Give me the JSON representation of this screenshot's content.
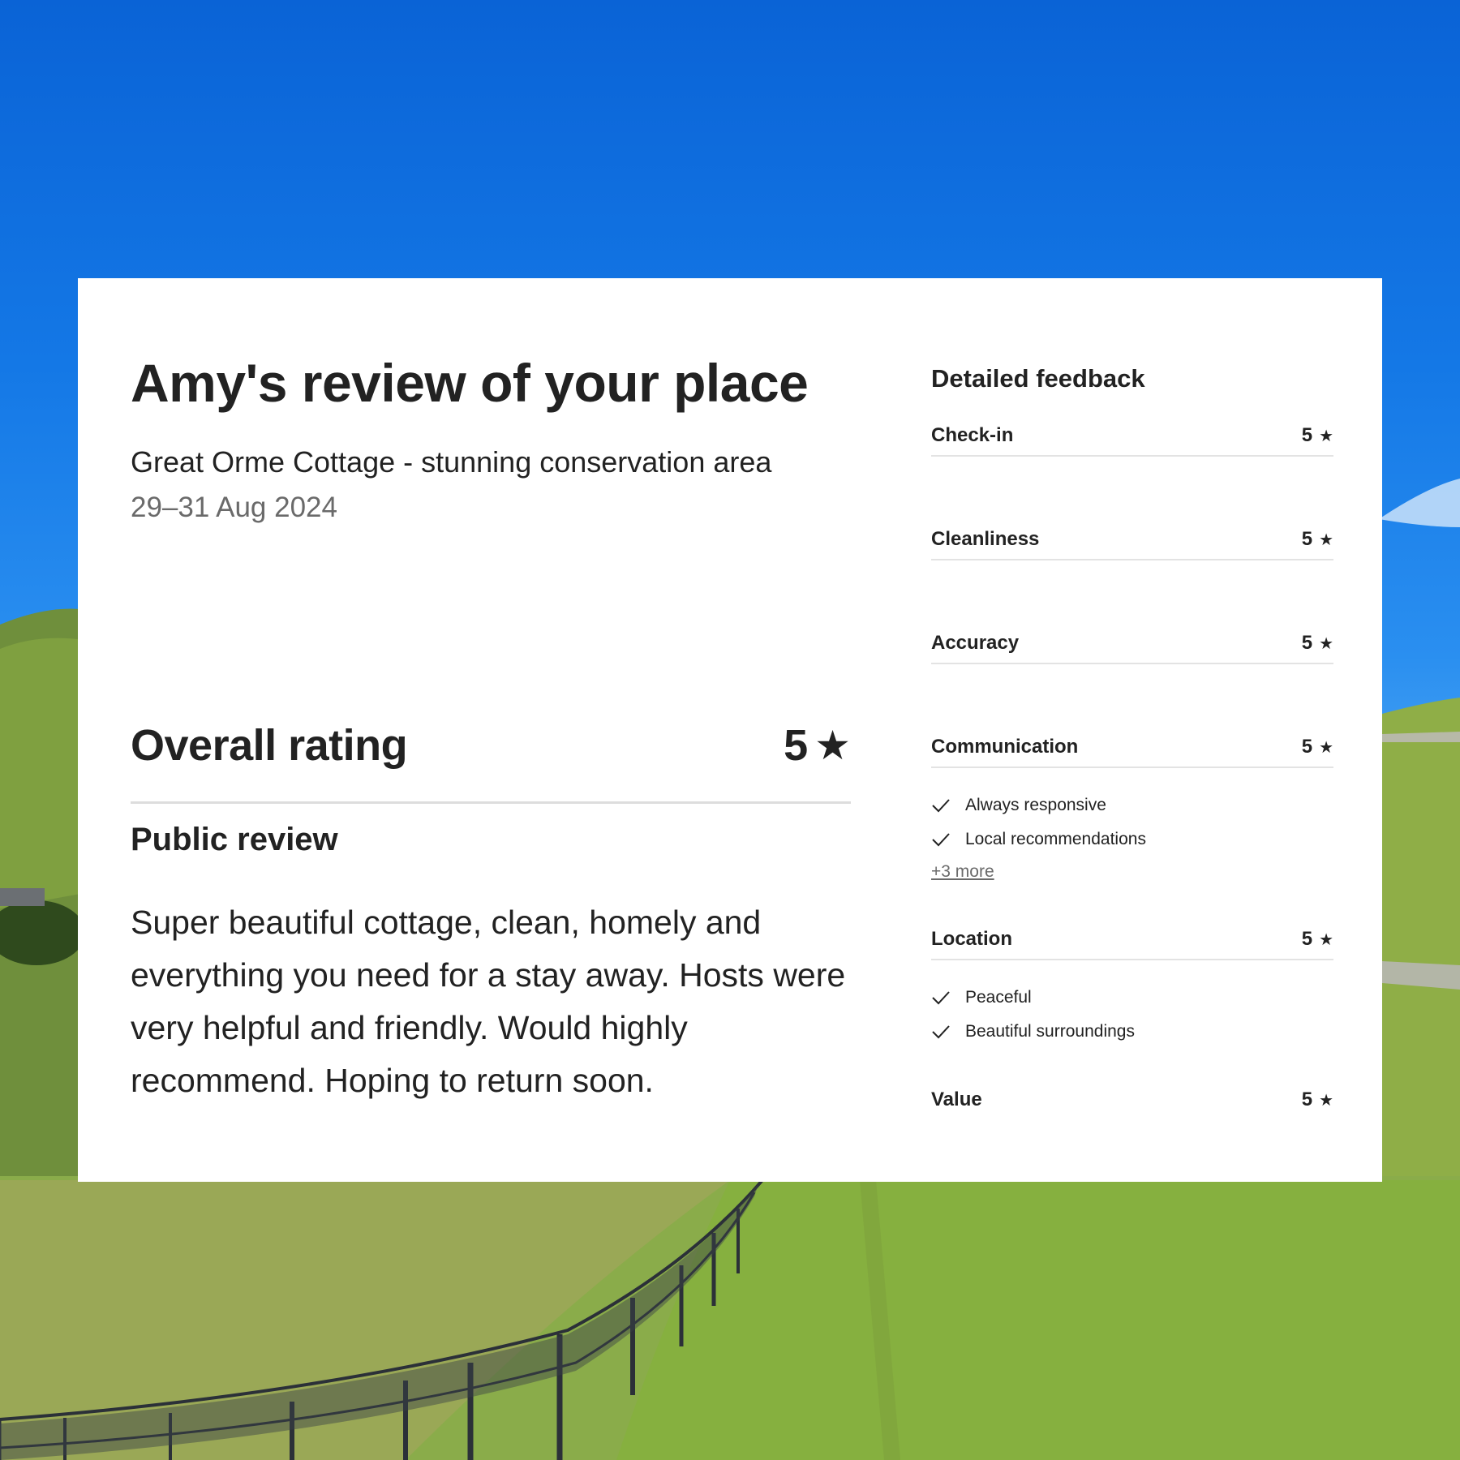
{
  "review": {
    "title": "Amy's review of your place",
    "listing_name": "Great Orme Cottage - stunning conservation area",
    "stay_dates": "29–31 Aug 2024",
    "overall_label": "Overall rating",
    "overall_score": "5",
    "public_review_heading": "Public review",
    "public_review_text": "Super beautiful cottage, clean, homely and everything you need for a stay away. Hosts were very helpful and friendly. Would highly recommend. Hoping to return soon."
  },
  "feedback": {
    "heading": "Detailed feedback",
    "categories": [
      {
        "label": "Check-in",
        "score": "5"
      },
      {
        "label": "Cleanliness",
        "score": "5"
      },
      {
        "label": "Accuracy",
        "score": "5"
      },
      {
        "label": "Communication",
        "score": "5",
        "tags": [
          "Always responsive",
          "Local recommendations"
        ],
        "more": "+3 more"
      },
      {
        "label": "Location",
        "score": "5",
        "tags": [
          "Peaceful",
          "Beautiful surroundings"
        ]
      },
      {
        "label": "Value",
        "score": "5"
      }
    ]
  },
  "icons": {
    "star": "star-icon",
    "check": "check-icon"
  },
  "colors": {
    "text_primary": "#222222",
    "text_secondary": "#6a6a6a",
    "divider": "#dddddd",
    "card_background": "#ffffff",
    "sky": "#1478e6",
    "grass": "#8db24a"
  }
}
